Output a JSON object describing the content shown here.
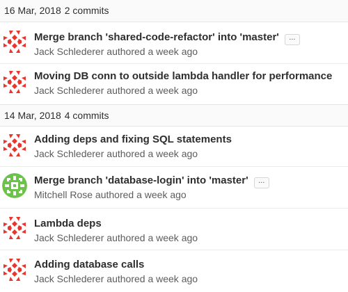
{
  "colors": {
    "avatar_red": "#e8362e",
    "avatar_green": "#6cc24a",
    "header_bg": "#fafafa",
    "border": "#e5e5e5"
  },
  "groups": [
    {
      "date": "16 Mar, 2018",
      "count": "2 commits",
      "commits": [
        {
          "title": "Merge branch 'shared-code-refactor' into 'master'",
          "author": "Jack Schlederer",
          "action": "authored",
          "time": "a week ago",
          "ellipsis": "...",
          "avatar": "red-identicon"
        },
        {
          "title": "Moving DB conn to outside lambda handler for performance",
          "author": "Jack Schlederer",
          "action": "authored",
          "time": "a week ago",
          "avatar": "red-identicon"
        }
      ]
    },
    {
      "date": "14 Mar, 2018",
      "count": "4 commits",
      "commits": [
        {
          "title": "Adding deps and fixing SQL statements",
          "author": "Jack Schlederer",
          "action": "authored",
          "time": "a week ago",
          "avatar": "red-identicon"
        },
        {
          "title": "Merge branch 'database-login' into 'master'",
          "author": "Mitchell Rose",
          "action": "authored",
          "time": "a week ago",
          "ellipsis": "...",
          "avatar": "green-identicon"
        },
        {
          "title": "Lambda deps",
          "author": "Jack Schlederer",
          "action": "authored",
          "time": "a week ago",
          "avatar": "red-identicon"
        },
        {
          "title": "Adding database calls",
          "author": "Jack Schlederer",
          "action": "authored",
          "time": "a week ago",
          "avatar": "red-identicon"
        }
      ]
    }
  ]
}
